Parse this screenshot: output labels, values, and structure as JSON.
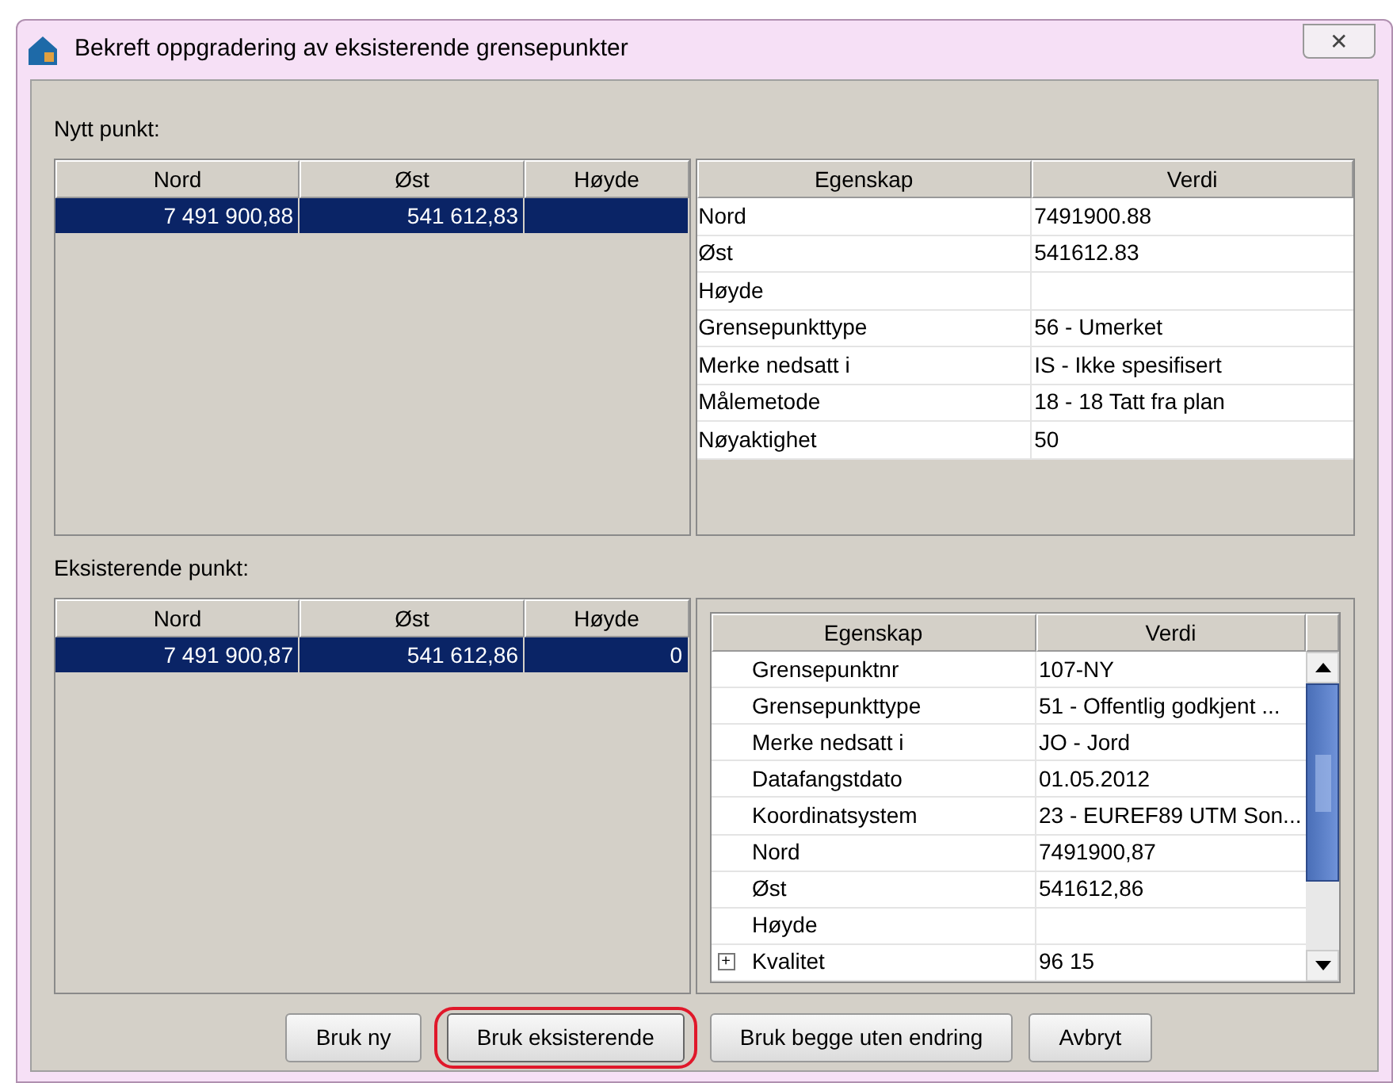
{
  "window": {
    "title": "Bekreft oppgradering av eksisterende grensepunkter",
    "close": "✕"
  },
  "sections": [
    {
      "label": "Nytt punkt:",
      "points": {
        "columns": [
          "Nord",
          "Øst",
          "Høyde"
        ],
        "rows": [
          {
            "selected": true,
            "cells": [
              "7 491 900,88",
              "541 612,83",
              ""
            ]
          }
        ]
      },
      "properties": {
        "framed": false,
        "scrollbar": false,
        "columns": [
          "Egenskap",
          "Verdi"
        ],
        "rows": [
          {
            "name": "Nord",
            "value": "7491900.88"
          },
          {
            "name": "Øst",
            "value": "541612.83"
          },
          {
            "name": "Høyde",
            "value": ""
          },
          {
            "name": "Grensepunkttype",
            "value": "56 - Umerket"
          },
          {
            "name": "Merke nedsatt i",
            "value": "IS - Ikke spesifisert"
          },
          {
            "name": "Målemetode",
            "value": "18 - 18 Tatt fra plan"
          },
          {
            "name": "Nøyaktighet",
            "value": "50"
          }
        ]
      }
    },
    {
      "label": "Eksisterende punkt:",
      "points": {
        "columns": [
          "Nord",
          "Øst",
          "Høyde"
        ],
        "rows": [
          {
            "selected": true,
            "cells": [
              "7 491 900,87",
              "541 612,86",
              "0"
            ]
          }
        ]
      },
      "properties": {
        "framed": true,
        "scrollbar": true,
        "columns": [
          "Egenskap",
          "Verdi"
        ],
        "rows": [
          {
            "name": "Grensepunktnr",
            "value": "107-NY"
          },
          {
            "name": "Grensepunkttype",
            "value": "51 - Offentlig godkjent ..."
          },
          {
            "name": "Merke nedsatt i",
            "value": "JO - Jord"
          },
          {
            "name": "Datafangstdato",
            "value": "01.05.2012"
          },
          {
            "name": "Koordinatsystem",
            "value": "23 - EUREF89 UTM Son..."
          },
          {
            "name": "Nord",
            "value": "7491900,87"
          },
          {
            "name": "Øst",
            "value": "541612,86"
          },
          {
            "name": "Høyde",
            "value": ""
          },
          {
            "name": "Kvalitet",
            "value": "96  15",
            "expander": "+"
          }
        ]
      }
    }
  ],
  "buttons": [
    {
      "label": "Bruk ny",
      "highlighted": false
    },
    {
      "label": "Bruk eksisterende",
      "highlighted": true
    },
    {
      "label": "Bruk begge uten endring",
      "highlighted": false
    },
    {
      "label": "Avbryt",
      "highlighted": false
    }
  ]
}
